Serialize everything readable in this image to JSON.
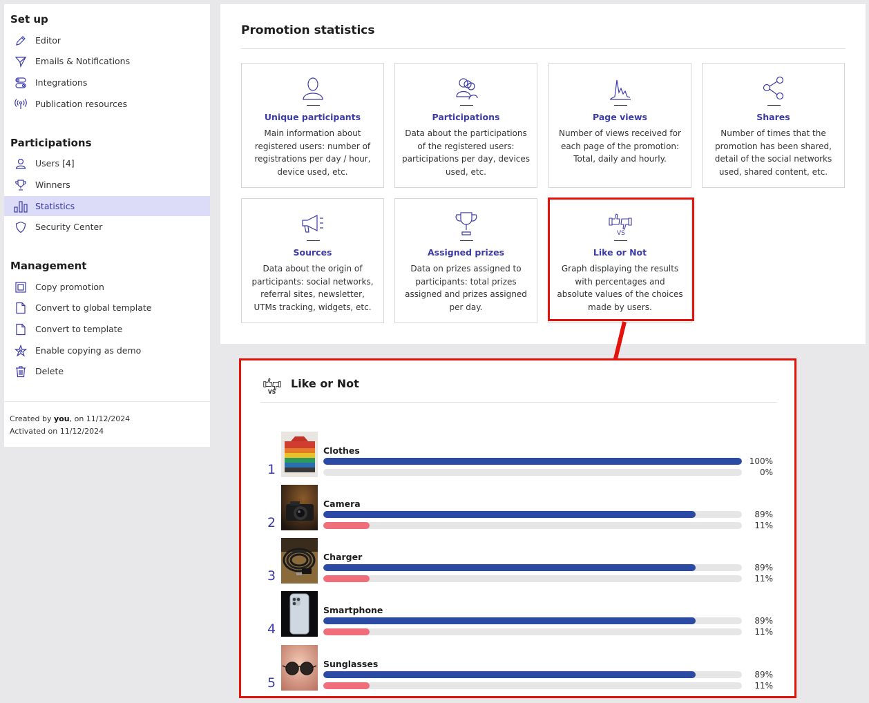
{
  "sidebar": {
    "setup_title": "Set up",
    "setup_items": [
      {
        "label": "Editor",
        "icon": "pencil-icon"
      },
      {
        "label": "Emails & Notifications",
        "icon": "paper-plane-icon"
      },
      {
        "label": "Integrations",
        "icon": "toggle-icon"
      },
      {
        "label": "Publication resources",
        "icon": "broadcast-icon"
      }
    ],
    "participations_title": "Participations",
    "participations_items": [
      {
        "label": "Users [4]",
        "icon": "user-icon"
      },
      {
        "label": "Winners",
        "icon": "trophy-icon"
      },
      {
        "label": "Statistics",
        "icon": "bar-chart-icon",
        "active": true
      },
      {
        "label": "Security Center",
        "icon": "shield-icon"
      }
    ],
    "management_title": "Management",
    "management_items": [
      {
        "label": "Copy promotion",
        "icon": "copy-icon"
      },
      {
        "label": "Convert to global template",
        "icon": "document-icon"
      },
      {
        "label": "Convert to template",
        "icon": "document-icon"
      },
      {
        "label": "Enable copying as demo",
        "icon": "star-icon"
      },
      {
        "label": "Delete",
        "icon": "trash-icon"
      }
    ],
    "created_prefix": "Created by ",
    "created_user": "you",
    "created_suffix": ", on 11/12/2024",
    "activated": "Activated on 11/12/2024"
  },
  "main": {
    "title": "Promotion statistics",
    "cards": [
      {
        "title": "Unique participants",
        "desc": "Main information about registered users: number of registrations per day / hour, device used, etc.",
        "icon": "user-icon"
      },
      {
        "title": "Participations",
        "desc": "Data about the participations of the registered users: participations per day, devices used, etc.",
        "icon": "users-icon"
      },
      {
        "title": "Page views",
        "desc": "Number of views received for each page of the promotion: Total, daily and hourly.",
        "icon": "line-chart-icon"
      },
      {
        "title": "Shares",
        "desc": "Number of times that the promotion has been shared, detail of the social networks used, shared content, etc.",
        "icon": "share-icon"
      },
      {
        "title": "Sources",
        "desc": "Data about the origin of participants: social networks, referral sites, newsletter, UTMs tracking, widgets, etc.",
        "icon": "megaphone-icon"
      },
      {
        "title": "Assigned prizes",
        "desc": "Data on prizes assigned to participants: total prizes assigned and prizes assigned per day.",
        "icon": "trophy-icon"
      },
      {
        "title": "Like or Not",
        "desc": "Graph displaying the results with percentages and absolute values of the choices made by users.",
        "icon": "thumbs-vs-icon"
      }
    ]
  },
  "like_or_not": {
    "title": "Like or Not",
    "vs_label": "VS",
    "colors": {
      "like": "#2b4aa3",
      "dislike": "#f06d7a",
      "track": "#e6e6e6"
    },
    "items": [
      {
        "rank": "1",
        "name": "Clothes",
        "like_pct": 100,
        "dislike_pct": 0,
        "like_label": "100%",
        "dislike_label": "0%",
        "image": "folded-clothes-image"
      },
      {
        "rank": "2",
        "name": "Camera",
        "like_pct": 89,
        "dislike_pct": 11,
        "like_label": "89%",
        "dislike_label": "11%",
        "image": "camera-image"
      },
      {
        "rank": "3",
        "name": "Charger",
        "like_pct": 89,
        "dislike_pct": 11,
        "like_label": "89%",
        "dislike_label": "11%",
        "image": "charger-cable-image"
      },
      {
        "rank": "4",
        "name": "Smartphone",
        "like_pct": 89,
        "dislike_pct": 11,
        "like_label": "89%",
        "dislike_label": "11%",
        "image": "smartphone-image"
      },
      {
        "rank": "5",
        "name": "Sunglasses",
        "like_pct": 89,
        "dislike_pct": 11,
        "like_label": "89%",
        "dislike_label": "11%",
        "image": "sunglasses-image"
      }
    ]
  }
}
